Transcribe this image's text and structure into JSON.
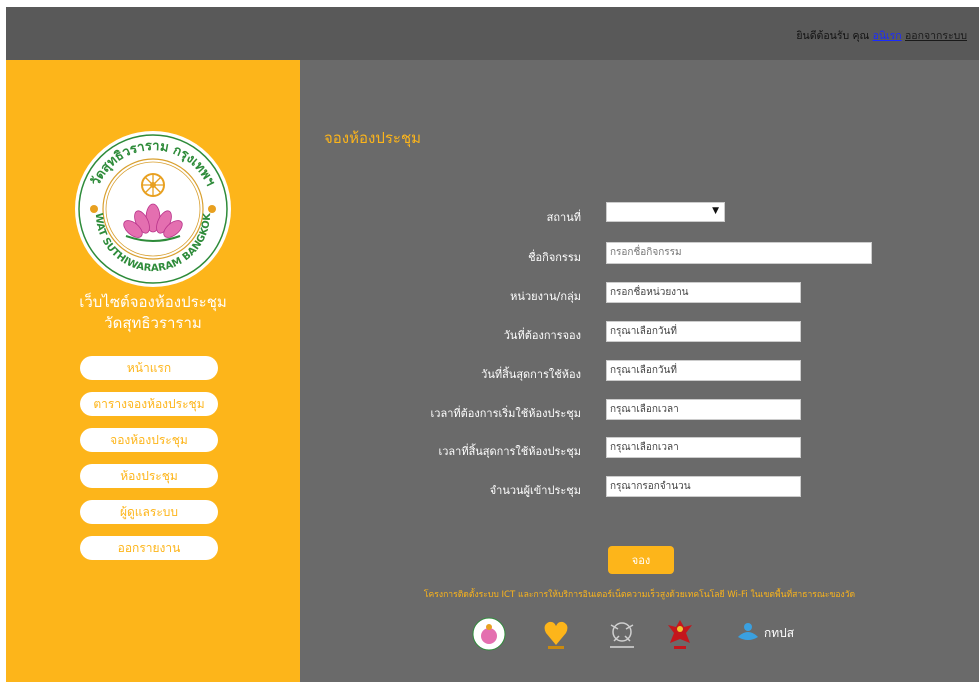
{
  "header": {
    "greeting": "ยินดีต้อนรับ คุณ",
    "user_name": "อนิเรก",
    "logout_label": "ออกจากระบบ"
  },
  "sidebar": {
    "seal_alt": "วัดสุทธิวราราม กรุงเทพฯ WAT SUTHIWARARAM BANGKOK",
    "site_title_line1": "เว็บไซต์จองห้องประชุม",
    "site_title_line2": "วัดสุทธิวราราม",
    "nav": [
      {
        "label": "หน้าแรก"
      },
      {
        "label": "ตารางจองห้องประชุม"
      },
      {
        "label": "จองห้องประชุม"
      },
      {
        "label": "ห้องประชุม"
      },
      {
        "label": "ผู้ดูแลระบบ"
      },
      {
        "label": "ออกรายงาน"
      }
    ]
  },
  "form": {
    "title": "จองห้องประชุม",
    "place_label": "สถานที่",
    "place_value": "",
    "activity_label": "ชื่อกิจกรรม",
    "activity_placeholder": "กรอกชื่อกิจกรรม",
    "unit_label": "หน่วยงาน/กลุ่ม",
    "unit_placeholder": "กรอกชื่อหน่วยงาน",
    "date_label": "วันที่ต้องการจอง",
    "date_placeholder": "กรุณาเลือกวันที่",
    "end_date_label": "วันที่สิ้นสุดการใช้ห้อง",
    "end_date_placeholder": "กรุณาเลือกวันที่",
    "start_time_label": "เวลาที่ต้องการเริ่มใช้ห้องประชุม",
    "start_time_placeholder": "กรุณาเลือกเวลา",
    "end_time_label": "เวลาที่สิ้นสุดการใช้ห้องประชุม",
    "end_time_placeholder": "กรุณาเลือกเวลา",
    "attendees_label": "จำนวนผู้เข้าประชุม",
    "attendees_placeholder": "กรุณากรอกจำนวน",
    "submit_label": "จอง"
  },
  "footer": {
    "note": "โครงการติดตั้งระบบ ICT และการให้บริการอินเตอร์เน็ตความเร็วสูงด้วยเทคโนโลยี Wi-Fi ในเขตพื้นที่สาธารณะของวัด",
    "partner_text": "กทปส"
  },
  "colors": {
    "accent": "#fdb51a",
    "header_bg": "#595959",
    "content_bg": "#6a6a6a"
  }
}
